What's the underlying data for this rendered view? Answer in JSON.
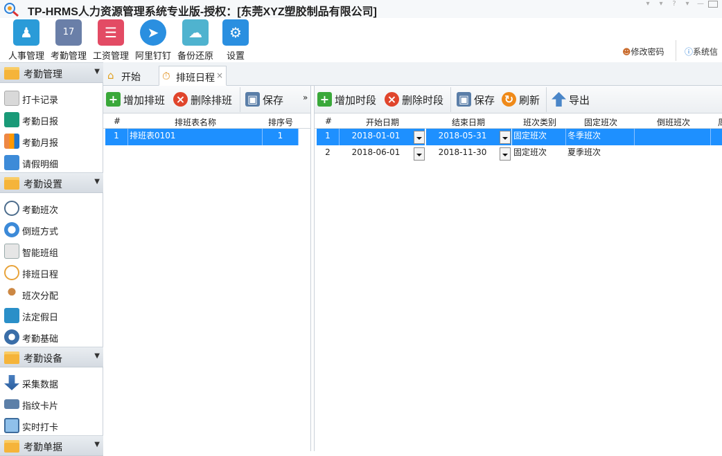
{
  "app": {
    "title": "TP-HRMS人力资源管理系统专业版-授权：[东莞XYZ塑胶制品有限公司]"
  },
  "toolbar": {
    "items": [
      {
        "label": "人事管理",
        "icon": "people-icon",
        "color": "#2a9bd8"
      },
      {
        "label": "考勤管理",
        "icon": "calendar-icon",
        "color": "#6a7fa8"
      },
      {
        "label": "工资管理",
        "icon": "payroll-icon",
        "color": "#e34b64"
      },
      {
        "label": "阿里钉钉",
        "icon": "dingtalk-icon",
        "color": "#2a8fe0"
      },
      {
        "label": "备份还原",
        "icon": "cloud-icon",
        "color": "#4fb3cf"
      },
      {
        "label": "设置",
        "icon": "gear-icon",
        "color": "#2a8fe0"
      }
    ],
    "change_password": "修改密码",
    "system_info": "系统信"
  },
  "sidebar": {
    "groups": [
      {
        "label": "考勤管理",
        "items": [
          {
            "label": "打卡记录",
            "icon": "punch-record-icon"
          },
          {
            "label": "考勤日报",
            "icon": "daily-report-icon"
          },
          {
            "label": "考勤月报",
            "icon": "monthly-report-icon"
          },
          {
            "label": "请假明细",
            "icon": "leave-icon"
          }
        ]
      },
      {
        "label": "考勤设置",
        "items": [
          {
            "label": "考勤班次",
            "icon": "clock-icon"
          },
          {
            "label": "倒班方式",
            "icon": "rotation-icon"
          },
          {
            "label": "智能班组",
            "icon": "smart-group-icon"
          },
          {
            "label": "排班日程",
            "icon": "stopwatch-icon"
          },
          {
            "label": "班次分配",
            "icon": "assign-icon"
          },
          {
            "label": "法定假日",
            "icon": "holiday-icon"
          },
          {
            "label": "考勤基础",
            "icon": "gear-icon"
          }
        ]
      },
      {
        "label": "考勤设备",
        "items": [
          {
            "label": "采集数据",
            "icon": "download-arrow-icon"
          },
          {
            "label": "指纹卡片",
            "icon": "card-icon"
          },
          {
            "label": "实时打卡",
            "icon": "monitor-icon"
          }
        ]
      },
      {
        "label": "考勤单据",
        "items": []
      }
    ]
  },
  "tabs": [
    {
      "label": "开始",
      "icon": "home-icon"
    },
    {
      "label": "排班日程",
      "icon": "stopwatch-icon",
      "close": "×"
    }
  ],
  "left_pane": {
    "toolbar": {
      "add": "增加排班",
      "delete": "删除排班",
      "save": "保存",
      "more": "»"
    },
    "columns": [
      "#",
      "排班表名称",
      "排序号"
    ],
    "rows": [
      {
        "num": "1",
        "name": "排班表0101",
        "order": "1"
      }
    ]
  },
  "right_pane": {
    "toolbar": {
      "add": "增加时段",
      "delete": "删除时段",
      "save": "保存",
      "refresh": "刷新",
      "export": "导出"
    },
    "columns": [
      "#",
      "开始日期",
      "结束日期",
      "班次类别",
      "固定班次",
      "倒班班次",
      "周"
    ],
    "rows": [
      {
        "num": "1",
        "start": "2018-01-01",
        "end": "2018-05-31",
        "type": "固定班次",
        "fixed": "冬季班次",
        "rotate": ""
      },
      {
        "num": "2",
        "start": "2018-06-01",
        "end": "2018-11-30",
        "type": "固定班次",
        "fixed": "夏季班次",
        "rotate": ""
      }
    ]
  }
}
